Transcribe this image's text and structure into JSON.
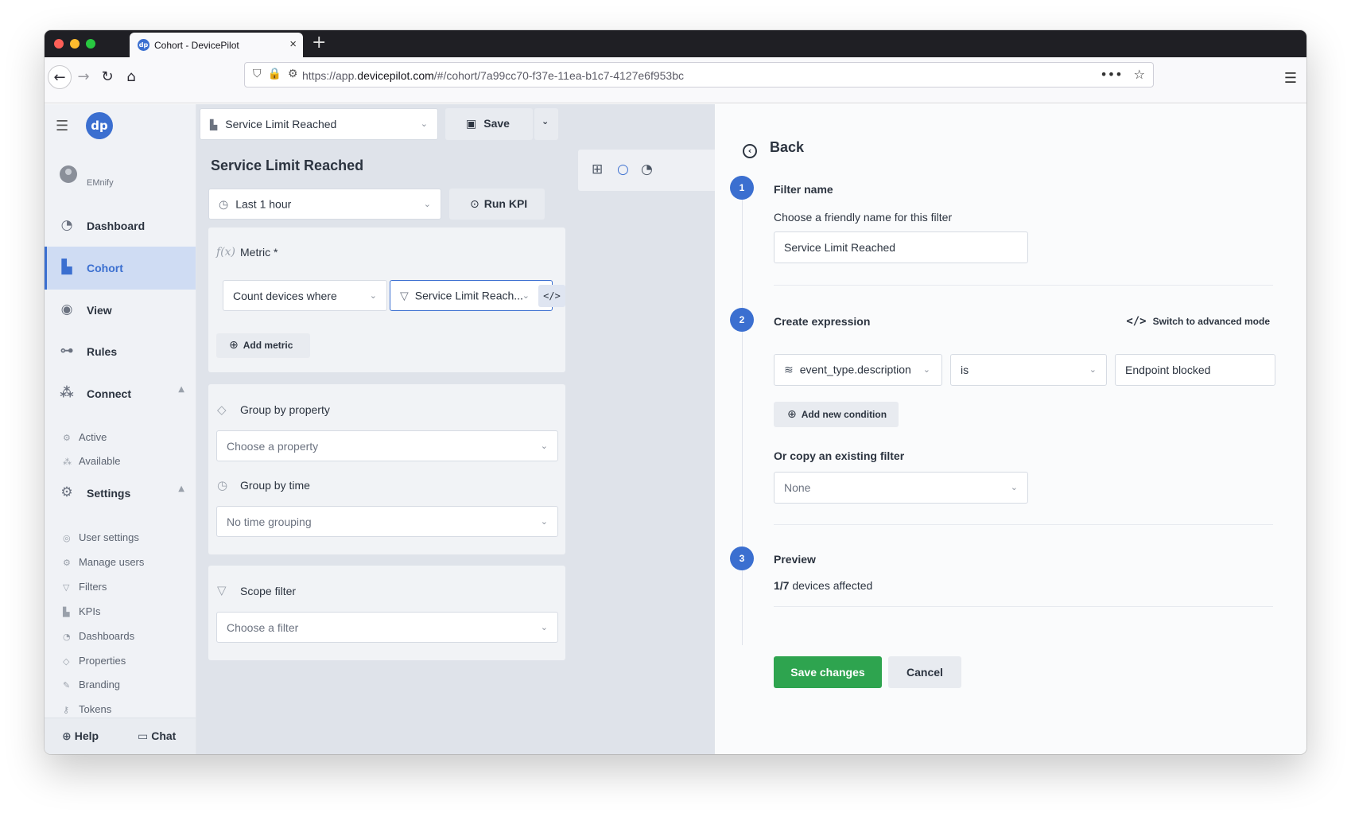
{
  "browser": {
    "tab_title": "Cohort - DevicePilot",
    "url_prefix": "https://app.",
    "url_domain": "devicepilot.com",
    "url_path": "/#/cohort/7a99cc70-f37e-11ea-b1c7-4127e6f953bc"
  },
  "sidebar": {
    "user": "EMnify",
    "items": [
      {
        "label": "Dashboard"
      },
      {
        "label": "Cohort"
      },
      {
        "label": "View"
      },
      {
        "label": "Rules"
      },
      {
        "label": "Connect"
      },
      {
        "label": "Settings"
      }
    ],
    "connect_sub": [
      "Active",
      "Available"
    ],
    "settings_sub": [
      "User settings",
      "Manage users",
      "Filters",
      "KPIs",
      "Dashboards",
      "Properties",
      "Branding",
      "Tokens"
    ],
    "help": "Help",
    "chat": "Chat"
  },
  "center": {
    "kpi_select": "Service Limit Reached",
    "save": "Save",
    "heading": "Service Limit Reached",
    "time_range": "Last 1 hour",
    "run_kpi": "Run KPI",
    "metric_label": "Metric *",
    "metric_count": "Count devices where",
    "metric_filter": "Service Limit Reach...",
    "add_metric": "Add metric",
    "group_by_property": "Group by property",
    "choose_property": "Choose a property",
    "group_by_time": "Group by time",
    "time_grouping": "No time grouping",
    "scope_filter": "Scope filter",
    "choose_filter": "Choose a filter"
  },
  "panel": {
    "back": "Back",
    "step1": "1",
    "filter_name_title": "Filter name",
    "filter_name_help": "Choose a friendly name for this filter",
    "filter_name_value": "Service Limit Reached",
    "step2": "2",
    "create_expression": "Create expression",
    "advanced_mode": "Switch to advanced mode",
    "expr_property": "event_type.description",
    "expr_operator": "is",
    "expr_value": "Endpoint blocked",
    "add_condition": "Add new condition",
    "copy_filter_title": "Or copy an existing filter",
    "copy_filter_value": "None",
    "step3": "3",
    "preview_title": "Preview",
    "preview_count": "1/7",
    "preview_text": "devices affected",
    "save_changes": "Save changes",
    "cancel": "Cancel"
  },
  "colors": {
    "accent": "#3b6fd0",
    "success": "#2ea44f"
  }
}
